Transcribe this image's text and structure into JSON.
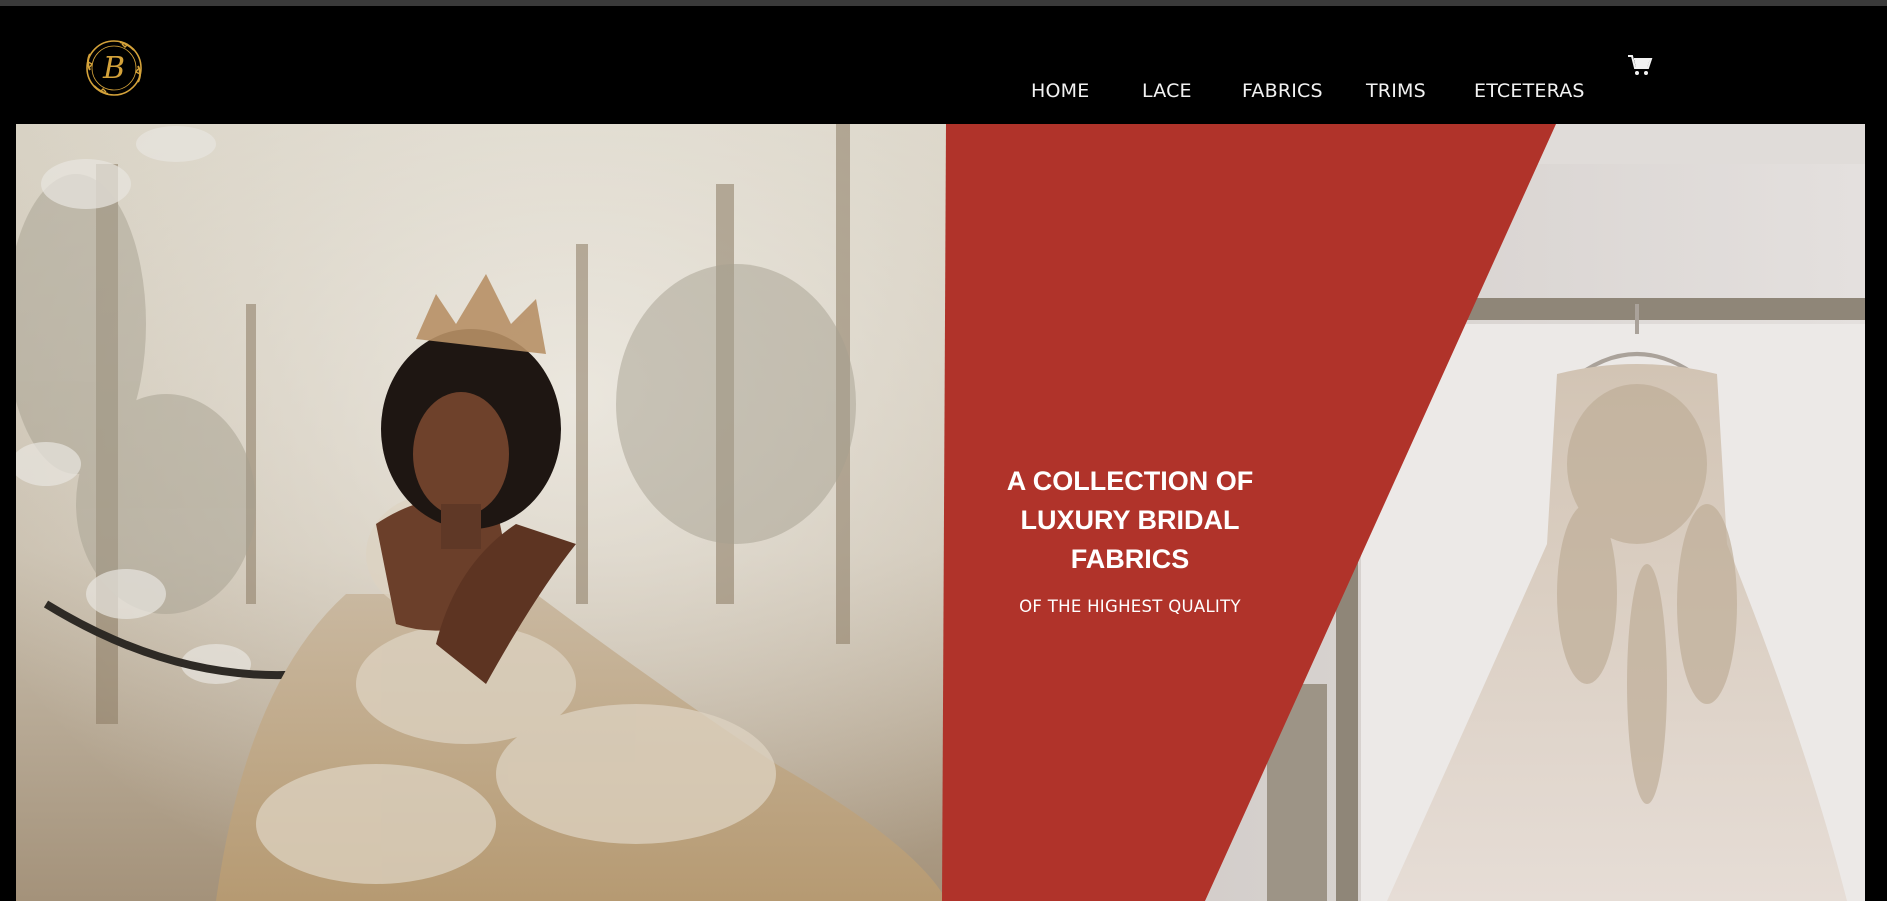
{
  "brand": {
    "logo_icon": "b-monogram-wreath-logo",
    "logo_letter": "B",
    "logo_color": "#d4a23a"
  },
  "nav": {
    "items": [
      {
        "label": "HOME"
      },
      {
        "label": "LACE"
      },
      {
        "label": "FABRICS"
      },
      {
        "label": "TRIMS"
      },
      {
        "label": "ETCETERAS"
      }
    ],
    "cart_icon": "cart-icon"
  },
  "hero": {
    "headline_line1": "A COLLECTION OF",
    "headline_line2": "LUXURY BRIDAL",
    "headline_line3": "FABRICS",
    "subheadline": "OF THE HIGHEST QUALITY",
    "accent_color": "#b0332a",
    "left_image": "bride-in-lace-gown-with-crown-photo",
    "right_image": "wedding-dress-on-hanger-photo"
  },
  "colors": {
    "header_bg": "#000000",
    "nav_text": "#f2f2f2"
  }
}
